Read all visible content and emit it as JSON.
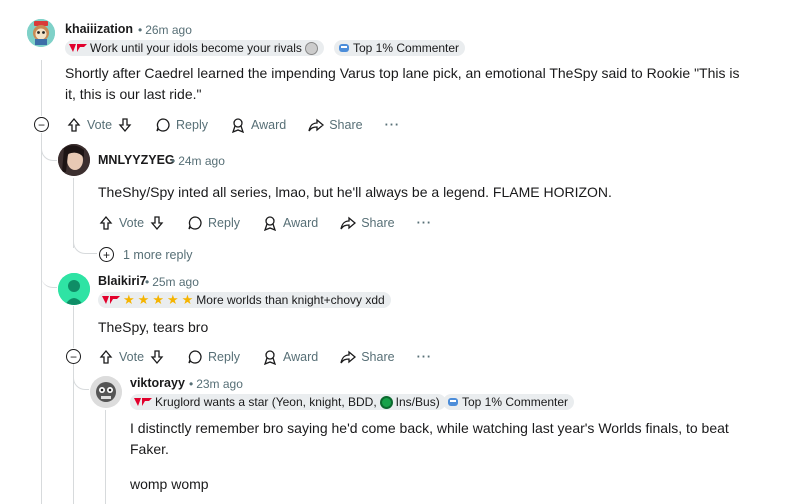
{
  "comments": [
    {
      "username": "khaiiization",
      "time": "26m ago",
      "flairs": [
        "Work until your idols become your rivals",
        "Top 1% Commenter"
      ],
      "body": "Shortly after Caedrel learned the impending Varus top lane pick, an emotional TheSpy said to Rookie \"This is it, this is our last ride.\""
    },
    {
      "username": "MNLYYZYEG",
      "time": "24m ago",
      "body": "TheShy/Spy inted all series, lmao, but he'll always be a legend. FLAME HORIZON.",
      "more_replies": "1 more reply"
    },
    {
      "username": "Blaikiri7",
      "time": "25m ago",
      "flairs": [
        "More worlds than knight+chovy xdd"
      ],
      "body": "TheSpy, tears bro"
    },
    {
      "username": "viktorayy",
      "time": "23m ago",
      "flairs": [
        "Kruglord wants a star (Yeon, knight, BDD,",
        "Ins/Bus)",
        "Top 1% Commenter"
      ],
      "body_lines": [
        "I distinctly remember bro saying he'd come back, while watching last year's Worlds finals, to beat",
        "Faker.",
        "womp womp"
      ]
    }
  ],
  "actions": {
    "vote": "Vote",
    "reply": "Reply",
    "award": "Award",
    "share": "Share",
    "more": "···"
  },
  "colors": {
    "meta": "#576f76",
    "flair_bg": "#eaedef",
    "thread_line": "#d7dadc",
    "t1_red": "#e2012d"
  },
  "icons": [
    "upvote-icon",
    "downvote-icon",
    "reply-icon",
    "award-icon",
    "share-icon",
    "collapse-icon",
    "expand-icon",
    "t1-logo-icon",
    "top-commenter-icon",
    "star-icon"
  ]
}
